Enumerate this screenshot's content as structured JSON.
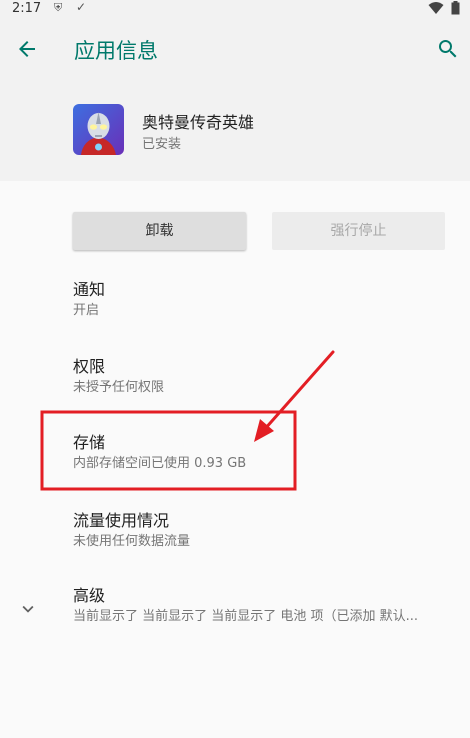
{
  "status_bar": {
    "time": "2:17"
  },
  "app_bar": {
    "title": "应用信息"
  },
  "app": {
    "name": "奥特曼传奇英雄",
    "status": "已安装"
  },
  "buttons": {
    "uninstall": "卸载",
    "force_stop": "强行停止"
  },
  "items": [
    {
      "title": "通知",
      "subtitle": "开启"
    },
    {
      "title": "权限",
      "subtitle": "未授予任何权限"
    },
    {
      "title": "存储",
      "subtitle": "内部存储空间已使用 0.93 GB"
    },
    {
      "title": "流量使用情况",
      "subtitle": "未使用任何数据流量"
    },
    {
      "title": "高级",
      "subtitle": "当前显示了 当前显示了 当前显示了 电池 项（已添加 默认..."
    }
  ],
  "colors": {
    "accent": "#00796b",
    "annotation": "#e31e24"
  }
}
